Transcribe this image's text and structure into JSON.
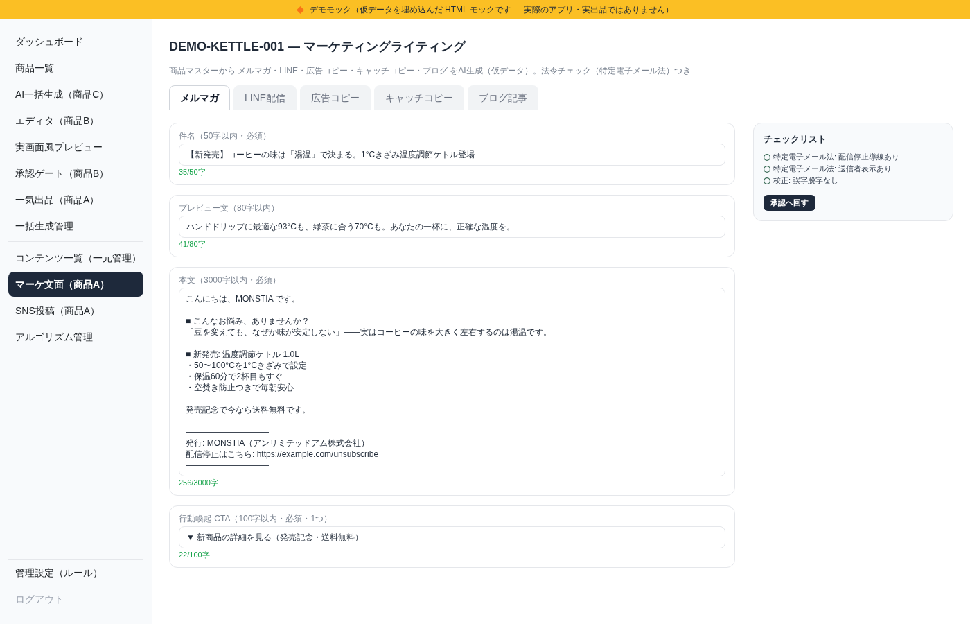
{
  "banner": {
    "text": "デモモック（仮データを埋め込んだ HTML モックです — 実際のアプリ・実出品ではありません）"
  },
  "sidebar": {
    "groups": [
      {
        "items": [
          {
            "label": "ダッシュボード",
            "selected": false
          },
          {
            "label": "商品一覧",
            "selected": false
          },
          {
            "label": "AI一括生成（商品C）",
            "selected": false
          },
          {
            "label": "エディタ（商品B）",
            "selected": false
          },
          {
            "label": "実画面風プレビュー",
            "selected": false
          },
          {
            "label": "承認ゲート（商品B）",
            "selected": false
          },
          {
            "label": "一気出品（商品A）",
            "selected": false
          },
          {
            "label": "一括生成管理",
            "selected": false
          }
        ]
      },
      {
        "items": [
          {
            "label": "コンテンツ一覧（一元管理）",
            "selected": false
          },
          {
            "label": "マーケ文面（商品A）",
            "selected": true
          },
          {
            "label": "SNS投稿（商品A）",
            "selected": false
          },
          {
            "label": "アルゴリズム管理",
            "selected": false
          }
        ]
      }
    ],
    "footer_items": [
      {
        "kind": "nav",
        "label": "管理設定（ルール）",
        "selected": false
      },
      {
        "kind": "logout",
        "label": "ログアウト",
        "selected": false
      }
    ]
  },
  "page": {
    "title": "DEMO-KETTLE-001 — マーケティングライティング",
    "subtitle": "商品マスターから メルマガ・LINE・広告コピー・キャッチコピー・ブログ をAI生成（仮データ）。法令チェック（特定電子メール法）つき"
  },
  "tabs": [
    {
      "label": "メルマガ",
      "selected": true
    },
    {
      "label": "LINE配信",
      "selected": false
    },
    {
      "label": "広告コピー",
      "selected": false
    },
    {
      "label": "キャッチコピー",
      "selected": false
    },
    {
      "label": "ブログ記事",
      "selected": false
    }
  ],
  "fields": [
    {
      "kind": "input",
      "label": "件名（50字以内・必須）",
      "value": "【新発売】コーヒーの味は「湯温」で決まる。1°Cきざみ温度調節ケトル登場",
      "count": "35/50字"
    },
    {
      "kind": "input",
      "label": "プレビュー文（80字以内）",
      "value": "ハンドドリップに最適な93°Cも、緑茶に合う70°Cも。あなたの一杯に、正確な温度を。",
      "count": "41/80字"
    },
    {
      "kind": "textarea",
      "label": "本文（3000字以内・必須）",
      "paragraphs": [
        {
          "lines": [
            "こんにちは、MONSTIA です。"
          ]
        },
        {
          "lines": [
            "■ こんなお悩み、ありませんか？",
            "「豆を変えても、なぜか味が安定しない」——実はコーヒーの味を大きく左右するのは湯温です。"
          ]
        },
        {
          "lines": [
            "■ 新発売: 温度調節ケトル 1.0L",
            "・50〜100°Cを1°Cきざみで設定",
            "・保温60分で2杯目もすぐ",
            "・空焚き防止つきで毎朝安心"
          ]
        },
        {
          "lines": [
            "発売記念で今なら送料無料です。"
          ]
        },
        {
          "lines": [
            "――――――――――",
            "発行: MONSTIA（アンリミテッドアム株式会社）",
            "配信停止はこちら: https://example.com/unsubscribe",
            "――――――――――"
          ]
        }
      ],
      "count": "256/3000字"
    },
    {
      "kind": "input",
      "label": "行動喚起 CTA（100字以内・必須・1つ）",
      "value": "▼ 新商品の詳細を見る（発売記念・送料無料）",
      "count": "22/100字"
    }
  ],
  "checklist": {
    "title": "チェックリスト",
    "items": [
      {
        "label": "特定電子メール法: 配信停止導線あり",
        "checked": false
      },
      {
        "label": "特定電子メール法: 送信者表示あり",
        "checked": false
      },
      {
        "label": "校正: 誤字脱字なし",
        "checked": false
      }
    ],
    "button": "承認へ回す"
  }
}
